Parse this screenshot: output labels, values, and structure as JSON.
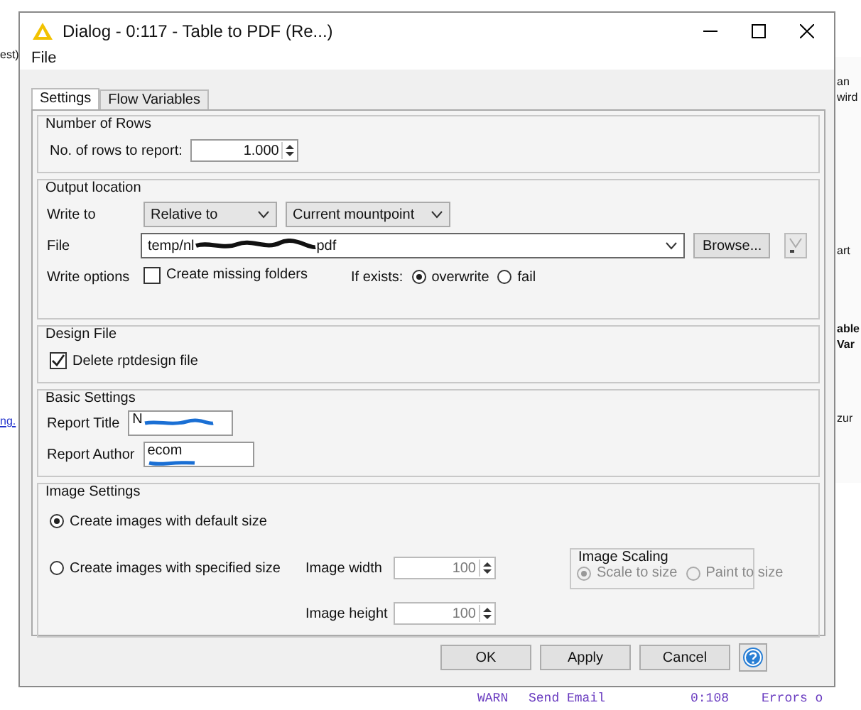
{
  "background": {
    "left_text": "est)",
    "left_link": "ng.",
    "right_texts": [
      "an",
      "wird",
      "art",
      "able",
      "Var",
      "zur"
    ],
    "console_lines": [
      {
        "level": "WARN",
        "node": "Send Email",
        "id": "0:108",
        "message": "Errors o"
      }
    ]
  },
  "window": {
    "title": "Dialog - 0:117 - Table to PDF (Re...)"
  },
  "menu": [
    "File"
  ],
  "tabs": [
    {
      "label": "Settings",
      "selected": true
    },
    {
      "label": "Flow Variables",
      "selected": false
    }
  ],
  "number_of_rows": {
    "title": "Number of Rows",
    "label": "No. of rows to report:",
    "value": "1.000"
  },
  "output_location": {
    "title": "Output location",
    "write_to_label": "Write to",
    "write_to": "Relative to",
    "mountpoint": "Current mountpoint",
    "file_label": "File",
    "file_prefix": "temp/nl",
    "file_suffix": "pdf",
    "browse": "Browse...",
    "write_options_label": "Write options",
    "create_missing_folders": {
      "label": "Create missing folders",
      "checked": false
    },
    "if_exists_label": "If exists:",
    "if_exists": [
      {
        "label": "overwrite",
        "selected": true
      },
      {
        "label": "fail",
        "selected": false
      }
    ]
  },
  "design_file": {
    "title": "Design File",
    "delete_rptdesign": {
      "label": "Delete rptdesign file",
      "checked": true
    }
  },
  "basic_settings": {
    "title": "Basic Settings",
    "fields": [
      {
        "label": "Report Title",
        "value": "N"
      },
      {
        "label": "Report Author",
        "value": "ecom"
      }
    ]
  },
  "image_settings": {
    "title": "Image Settings",
    "size_options": [
      {
        "label": "Create images with default size",
        "selected": true
      },
      {
        "label": "Create images with specified size",
        "selected": false
      }
    ],
    "width": {
      "label": "Image width",
      "value": "100",
      "disabled": true
    },
    "height": {
      "label": "Image height",
      "value": "100",
      "disabled": true
    },
    "scaling": {
      "title": "Image Scaling",
      "disabled": true,
      "options": [
        {
          "label": "Scale to size",
          "selected": true
        },
        {
          "label": "Paint to size",
          "selected": false
        }
      ]
    }
  },
  "buttons": [
    "OK",
    "Apply",
    "Cancel"
  ]
}
